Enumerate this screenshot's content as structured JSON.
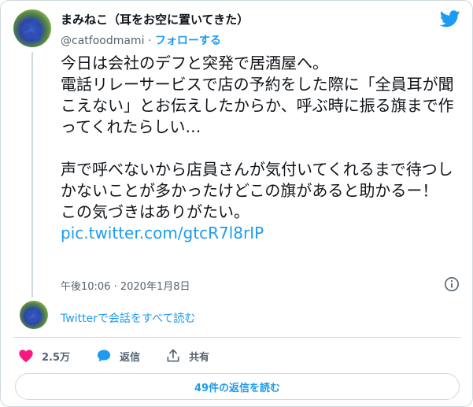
{
  "author": {
    "display_name": "まみねこ（耳をお空に置いてきた）",
    "handle": "@catfoodmami",
    "separator": "·",
    "follow_label": "フォローする"
  },
  "tweet": {
    "text": "今日は会社のデフと突発で居酒屋へ。\n電話リレーサービスで店の予約をした際に「全員耳が聞こえない」とお伝えしたからか、呼ぶ時に振る旗まで作ってくれたらしい…\n\n声で呼べないから店員さんが気付いてくれるまで待つしかないことが多かったけどこの旗があると助かるー！\nこの気づきはありがたい。",
    "link": "pic.twitter.com/gtcR7l8rIP",
    "timestamp": "午後10:06 · 2020年1月8日"
  },
  "thread": {
    "read_conversation": "Twitterで会話をすべて読む"
  },
  "actions": {
    "like_count": "2.5万",
    "reply_label": "返信",
    "share_label": "共有"
  },
  "replies_button": "49件の返信を読む",
  "colors": {
    "accent": "#1d9bf0",
    "like": "#f91880",
    "muted": "#536471",
    "border": "#cfd9de"
  },
  "icons": [
    "twitter-bird-icon",
    "info-icon",
    "heart-icon",
    "reply-bubble-icon",
    "share-icon"
  ]
}
